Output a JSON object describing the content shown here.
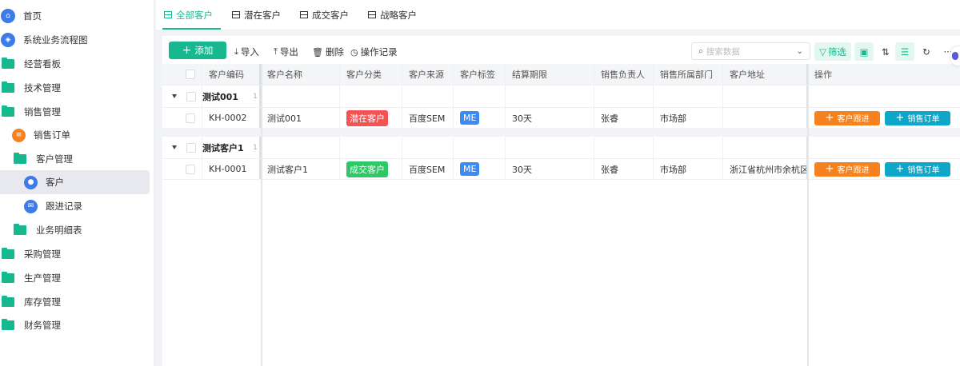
{
  "sidebar": {
    "items": [
      {
        "label": "首页",
        "icon": "home-icon"
      },
      {
        "label": "系统业务流程图",
        "icon": "cube-icon"
      },
      {
        "label": "经营看板",
        "icon": "folder-icon"
      },
      {
        "label": "技术管理",
        "icon": "folder-icon"
      },
      {
        "label": "销售管理",
        "icon": "folder-open-icon"
      },
      {
        "label": "销售订单",
        "icon": "document-icon"
      },
      {
        "label": "客户管理",
        "icon": "folder-open-icon"
      },
      {
        "label": "客户",
        "icon": "user-icon",
        "selected": true
      },
      {
        "label": "跟进记录",
        "icon": "mail-icon"
      },
      {
        "label": "业务明细表",
        "icon": "folder-icon"
      },
      {
        "label": "采购管理",
        "icon": "folder-icon"
      },
      {
        "label": "生产管理",
        "icon": "folder-icon"
      },
      {
        "label": "库存管理",
        "icon": "folder-icon"
      },
      {
        "label": "财务管理",
        "icon": "folder-icon"
      }
    ]
  },
  "tabs": [
    {
      "label": "全部客户",
      "active": true
    },
    {
      "label": "潜在客户"
    },
    {
      "label": "成交客户"
    },
    {
      "label": "战略客户"
    }
  ],
  "toolbar": {
    "add": "添加",
    "import": "导入",
    "export": "导出",
    "delete": "删除",
    "log": "操作记录",
    "search_placeholder": "搜索数据",
    "filter": "筛选"
  },
  "table": {
    "headers": [
      "客户编码",
      "客户名称",
      "客户分类",
      "客户来源",
      "客户标签",
      "结算期限",
      "销售负责人",
      "销售所属部门",
      "客户地址",
      "操作"
    ],
    "groups": [
      {
        "name": "测试001",
        "count": "1",
        "row": {
          "code": "KH-0002",
          "name": "测试001",
          "category": "潜在客户",
          "category_color": "#f55353",
          "source": "百度SEM",
          "tag": "ME",
          "term": "30天",
          "owner": "张睿",
          "dept": "市场部",
          "address": ""
        }
      },
      {
        "name": "测试客户1",
        "count": "1",
        "row": {
          "code": "KH-0001",
          "name": "测试客户1",
          "category": "成交客户",
          "category_color": "#2ec866",
          "source": "百度SEM",
          "tag": "ME",
          "term": "30天",
          "owner": "张睿",
          "dept": "市场部",
          "address": "浙江省杭州市余杭区ZJ"
        }
      }
    ],
    "actions": {
      "follow": "客户跟进",
      "order": "销售订单",
      "follow_color": "#f5821f",
      "order_color": "#0ea7c9"
    },
    "tag_color": "#3d8bf2"
  }
}
